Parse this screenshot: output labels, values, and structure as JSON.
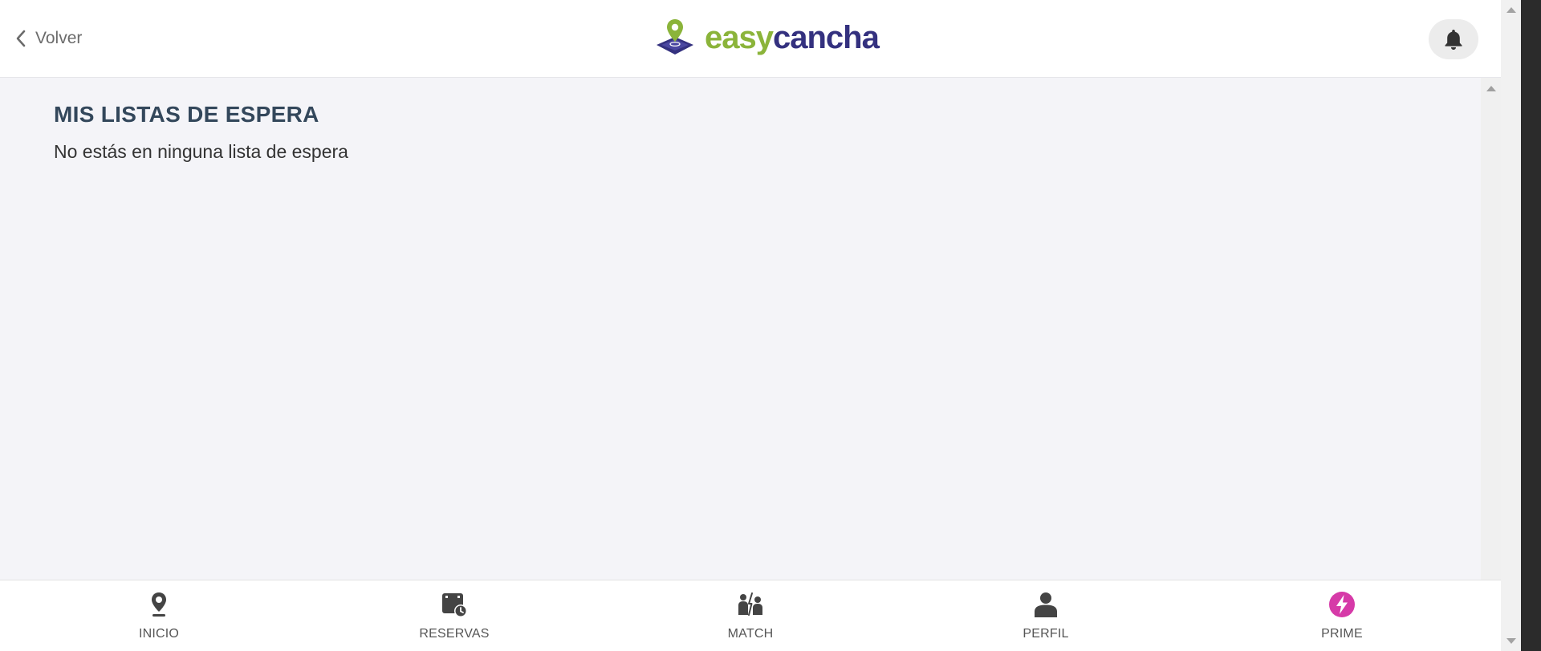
{
  "header": {
    "back_label": "Volver",
    "back_icon": "chevron-left-icon",
    "logo": {
      "part1": "easy",
      "part2": "cancha",
      "color_easy": "#8bb43a",
      "color_cancha": "#34317f"
    },
    "notification_icon": "bell-icon"
  },
  "main": {
    "title": "MIS LISTAS DE ESPERA",
    "empty_message": "No estás en ninguna lista de espera"
  },
  "bottom_nav": {
    "items": [
      {
        "label": "INICIO",
        "icon": "location-pin-icon"
      },
      {
        "label": "RESERVAS",
        "icon": "calendar-clock-icon"
      },
      {
        "label": "MATCH",
        "icon": "players-match-icon"
      },
      {
        "label": "PERFIL",
        "icon": "user-icon"
      },
      {
        "label": "PRIME",
        "icon": "lightning-icon",
        "color": "#d63aa8"
      }
    ]
  },
  "colors": {
    "content_bg": "#f4f4f8",
    "title": "#33475b",
    "nav_icon": "#444444"
  }
}
